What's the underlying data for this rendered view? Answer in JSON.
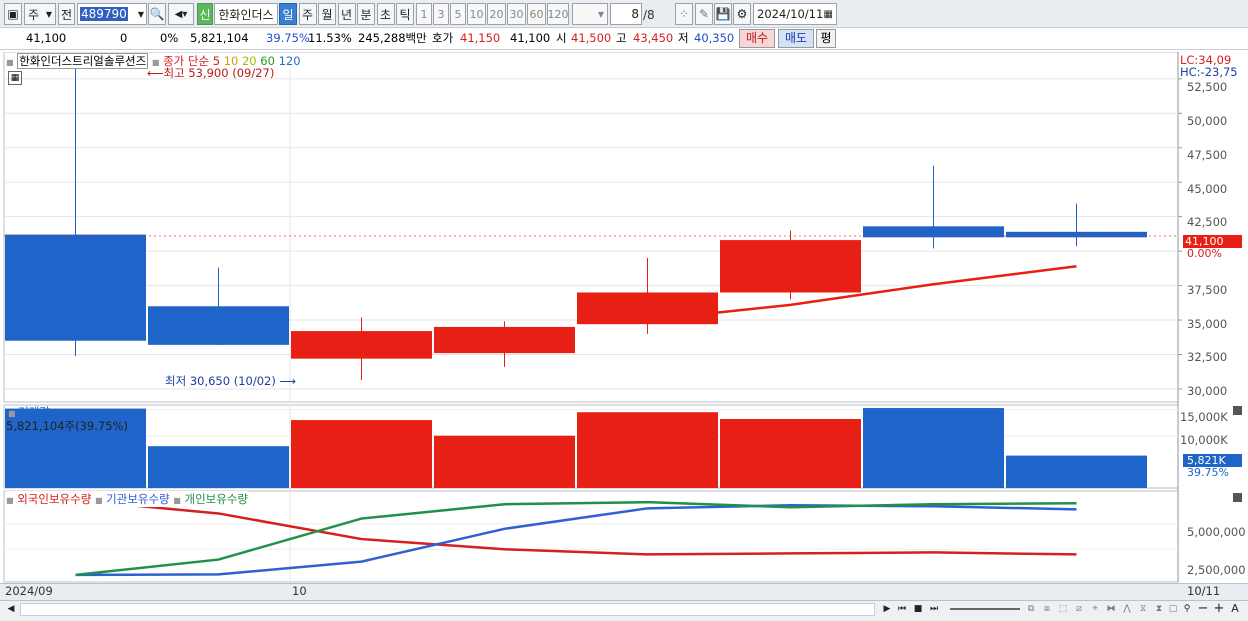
{
  "toolbar": {
    "period_select": "주",
    "prev_label": "전",
    "code_value": "489790",
    "shin_badge": "신",
    "stock_name": "한화인더스",
    "periods": [
      "일",
      "주",
      "월",
      "년",
      "분",
      "초",
      "틱"
    ],
    "active_period": "일",
    "intervals": [
      "1",
      "3",
      "5",
      "10",
      "20",
      "30",
      "60",
      "120"
    ],
    "page_counter": "8",
    "page_total": "/8",
    "date_value": "2024/10/11"
  },
  "quote": {
    "price": "41,100",
    "change": "0",
    "change_pct": "0%",
    "volume": "5,821,104",
    "vol_ratio": "39.75%",
    "turnover_pct": "11.53%",
    "amount": "245,288백만",
    "hoga_label": "호가",
    "hoga_value": "41,150",
    "prev_close": "41,100",
    "open_label": "시",
    "open_value": "41,500",
    "high_label": "고",
    "high_value": "43,450",
    "low_label": "저",
    "low_value": "40,350",
    "buy_label": "매수",
    "sell_label": "매도",
    "avg_label": "평"
  },
  "price_panel": {
    "name": "한화인더스트리얼솔루션즈",
    "ma_label": "종가 단순",
    "ma_periods": [
      "5",
      "10",
      "20",
      "60",
      "120"
    ],
    "ma_colors": [
      "#d42020",
      "#d4a000",
      "#a0c000",
      "#20a020",
      "#2070c0"
    ],
    "high_marker": "최고 53,900 (09/27)",
    "low_marker": "최저 30,650 (10/02)",
    "lc": "LC:34,09",
    "hc": "HC:-23,75",
    "current_tag": "41,100",
    "current_pct": "0.00%",
    "axis_labels": [
      "52,500",
      "50,000",
      "47,500",
      "45,000",
      "42,500",
      "37,500",
      "35,000",
      "32,500",
      "30,000"
    ]
  },
  "volume_panel": {
    "title": "거래량",
    "value_label": "5,821,104주(39.75%)",
    "axis_labels": [
      "15,000K",
      "10,000K"
    ],
    "current_tag": "5,821K",
    "current_pct": "39.75%"
  },
  "holdings_panel": {
    "legend": [
      "외국인보유수량",
      "기관보유수량",
      "개인보유수량"
    ],
    "legend_colors": [
      "#d42020",
      "#3060d0",
      "#20904a"
    ],
    "axis_labels": [
      "5,000,000",
      "2,500,000"
    ]
  },
  "xaxis": {
    "start": "2024/09",
    "mid": "10",
    "end": "10/11"
  },
  "chart_data": {
    "type": "candlestick",
    "candles": [
      {
        "o": 41200,
        "c": 33500,
        "h": 53900,
        "l": 32400,
        "color": "#1f64c8"
      },
      {
        "o": 36000,
        "c": 33200,
        "h": 38800,
        "l": 33200,
        "color": "#1f64c8"
      },
      {
        "o": 32200,
        "c": 34200,
        "h": 35200,
        "l": 30650,
        "color": "#e81f14"
      },
      {
        "o": 32600,
        "c": 34500,
        "h": 34900,
        "l": 31600,
        "color": "#e81f14"
      },
      {
        "o": 34700,
        "c": 37000,
        "h": 39500,
        "l": 34000,
        "color": "#e81f14"
      },
      {
        "o": 37000,
        "c": 40800,
        "h": 41500,
        "l": 36500,
        "color": "#e81f14"
      },
      {
        "o": 41800,
        "c": 41000,
        "h": 46200,
        "l": 40200,
        "color": "#1f64c8"
      },
      {
        "o": 41400,
        "c": 41000,
        "h": 43450,
        "l": 40350,
        "color": "#1f64c8"
      }
    ],
    "ma5": [
      null,
      null,
      null,
      null,
      35000,
      36100,
      37600,
      38900
    ],
    "volume": [
      15200,
      8000,
      13000,
      10000,
      14500,
      13200,
      15300,
      6200
    ],
    "holdings": {
      "foreign": [
        7300000,
        6000000,
        3500000,
        2500000,
        2000000,
        2100000,
        2200000,
        2000000
      ],
      "institution": [
        0,
        50000,
        1300000,
        4500000,
        6500000,
        6800000,
        6700000,
        6400000
      ],
      "individual": [
        0,
        1500000,
        5500000,
        6900000,
        7100000,
        6600000,
        6900000,
        7000000
      ]
    },
    "ylim": [
      29200,
      54300
    ],
    "vol_ylim": [
      0,
      15500
    ],
    "hold_ylim": [
      -300000,
      7800000
    ]
  }
}
